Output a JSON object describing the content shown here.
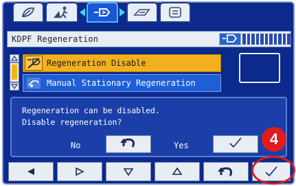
{
  "tabs": [
    {
      "icon": "leaf-icon"
    },
    {
      "icon": "person-walking-icon"
    },
    {
      "icon": "exhaust-filter-icon",
      "active": true
    },
    {
      "icon": "tool-icon"
    },
    {
      "icon": "list-icon"
    }
  ],
  "header": {
    "title": "KDPF Regeneration",
    "status_icon": "exhaust-filter-icon"
  },
  "list": {
    "items": [
      {
        "label": "Regeneration Disable",
        "icon": "regeneration-disable-icon",
        "selected": true
      },
      {
        "label": "Manual Stationary Regeneration",
        "icon": "manual-regeneration-icon",
        "selected": false
      }
    ]
  },
  "dialog": {
    "line1": "Regeneration can be disabled.",
    "line2": "Disable regeneration?",
    "no_label": "No",
    "yes_label": "Yes"
  },
  "badge": {
    "number": "4"
  },
  "bottom_bar": {
    "buttons": [
      "arrow-left-icon",
      "arrow-right-icon",
      "arrow-down-icon",
      "arrow-up-icon",
      "back-icon",
      "checkmark-icon"
    ]
  },
  "colors": {
    "background": "#0b2a8c",
    "selected": "#f2b01e",
    "badge": "#e21c1c",
    "highlight_ring": "#d81d1d",
    "accent_arrow": "#3ed7ff"
  }
}
